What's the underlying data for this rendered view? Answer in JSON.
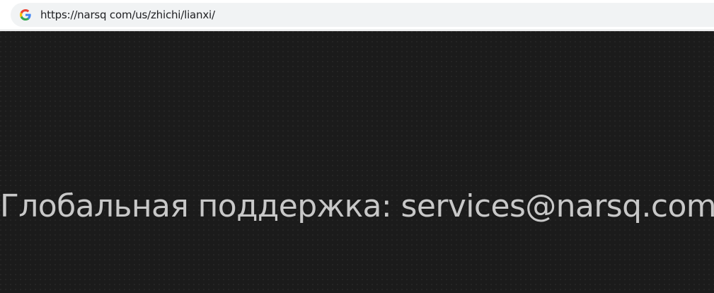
{
  "browser": {
    "url": "https://narsq com/us/zhichi/lianxi/",
    "site_icon": "google-g-icon"
  },
  "page": {
    "support_text": "Глобальная поддержка: services@narsq.com",
    "background_color": "#1b1b1b",
    "text_color": "#c8c8c8"
  }
}
